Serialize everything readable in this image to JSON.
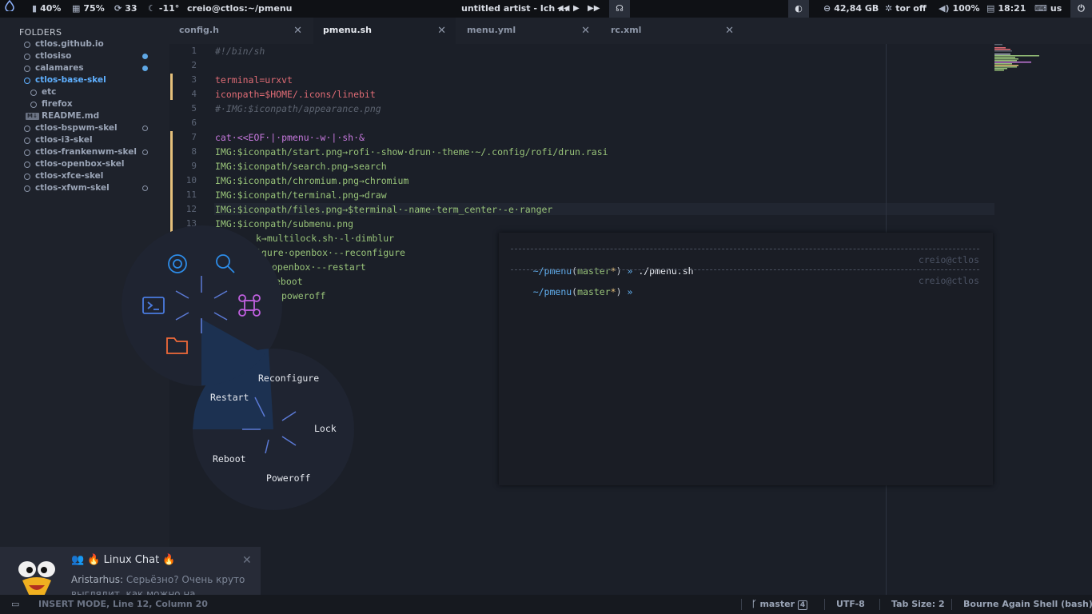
{
  "topbar": {
    "battery": "40%",
    "memory": "75%",
    "updates": "33",
    "temperature": "-11°",
    "window_title": "creio@ctlos:~/pmenu",
    "media_title": "untitled artist - Ich ...",
    "disk": "42,84 GB",
    "tor": "tor off",
    "volume": "100%",
    "clock": "18:21",
    "keyboard": "us"
  },
  "sidebar": {
    "header": "FOLDERS",
    "items": [
      {
        "label": "ctlos.github.io",
        "marker": "none"
      },
      {
        "label": "ctlosiso",
        "marker": "filled"
      },
      {
        "label": "calamares",
        "marker": "filled"
      },
      {
        "label": "ctlos-base-skel",
        "marker": "none"
      },
      {
        "label": "etc",
        "marker": "none"
      },
      {
        "label": "firefox",
        "marker": "none"
      },
      {
        "label": "README.md",
        "marker": "none"
      },
      {
        "label": "ctlos-bspwm-skel",
        "marker": "ring"
      },
      {
        "label": "ctlos-i3-skel",
        "marker": "none"
      },
      {
        "label": "ctlos-frankenwm-skel",
        "marker": "ring"
      },
      {
        "label": "ctlos-openbox-skel",
        "marker": "none"
      },
      {
        "label": "ctlos-xfce-skel",
        "marker": "none"
      },
      {
        "label": "ctlos-xfwm-skel",
        "marker": "ring"
      }
    ]
  },
  "tabs": [
    {
      "label": "config.h",
      "active": false
    },
    {
      "label": "pmenu.sh",
      "active": true
    },
    {
      "label": "menu.yml",
      "active": false
    },
    {
      "label": "rc.xml",
      "active": false
    }
  ],
  "editor": {
    "line_numbers": [
      "1",
      "2",
      "3",
      "4",
      "5",
      "6",
      "7",
      "8",
      "9",
      "10",
      "11",
      "12",
      "13"
    ],
    "lines": [
      "#!/bin/sh",
      "",
      "terminal=urxvt",
      "iconpath=$HOME/.icons/linebit",
      "#·IMG:$iconpath/appearance.png",
      "",
      "cat·<<EOF·|·pmenu·-w·|·sh·&",
      "IMG:$iconpath/start.png→rofi·-show·drun·-theme·~/.config/rofi/drun.rasi",
      "IMG:$iconpath/search.png→search",
      "IMG:$iconpath/chromium.png→chromium",
      "IMG:$iconpath/terminal.png→draw",
      "IMG:$iconpath/files.png→$terminal·-name·term_center·-e·ranger",
      "IMG:$iconpath/submenu.png"
    ],
    "hidden_lines": [
      "k→multilock.sh·-l·dimblur",
      "igure·openbox·--reconfigure",
      "openbox·--restart",
      "eboot",
      "poweroff"
    ]
  },
  "terminal": {
    "prompt_path": "~/pmenu",
    "branch": "master",
    "dirty_mark": "*",
    "prompt_symbol": "»",
    "command": "./pmenu.sh",
    "user_host": "creio@ctlos"
  },
  "pmenu": {
    "submenu_labels": [
      "Reconfigure",
      "Restart",
      "Lock",
      "Reboot",
      "Poweroff"
    ],
    "icons": [
      "settings-icon",
      "search-icon",
      "terminal-icon",
      "command-icon",
      "folder-icon",
      "play-icon"
    ]
  },
  "notification": {
    "title": "👥 🔥 Linux Chat 🔥",
    "sender": "Aristarhus:",
    "message": "Серьёзно? Очень круто выглядит, как можно на..."
  },
  "statusbar": {
    "mode": "INSERT MODE, Line 12, Column 20",
    "branch": "master",
    "branch_count": "4",
    "encoding": "UTF-8",
    "tab_size": "Tab Size: 2",
    "syntax": "Bourne Again Shell (bash)"
  },
  "colors": {
    "accent": "#5fb0ff",
    "editor_bg": "#1b1f28",
    "modified_marker": "#e5c07b"
  }
}
